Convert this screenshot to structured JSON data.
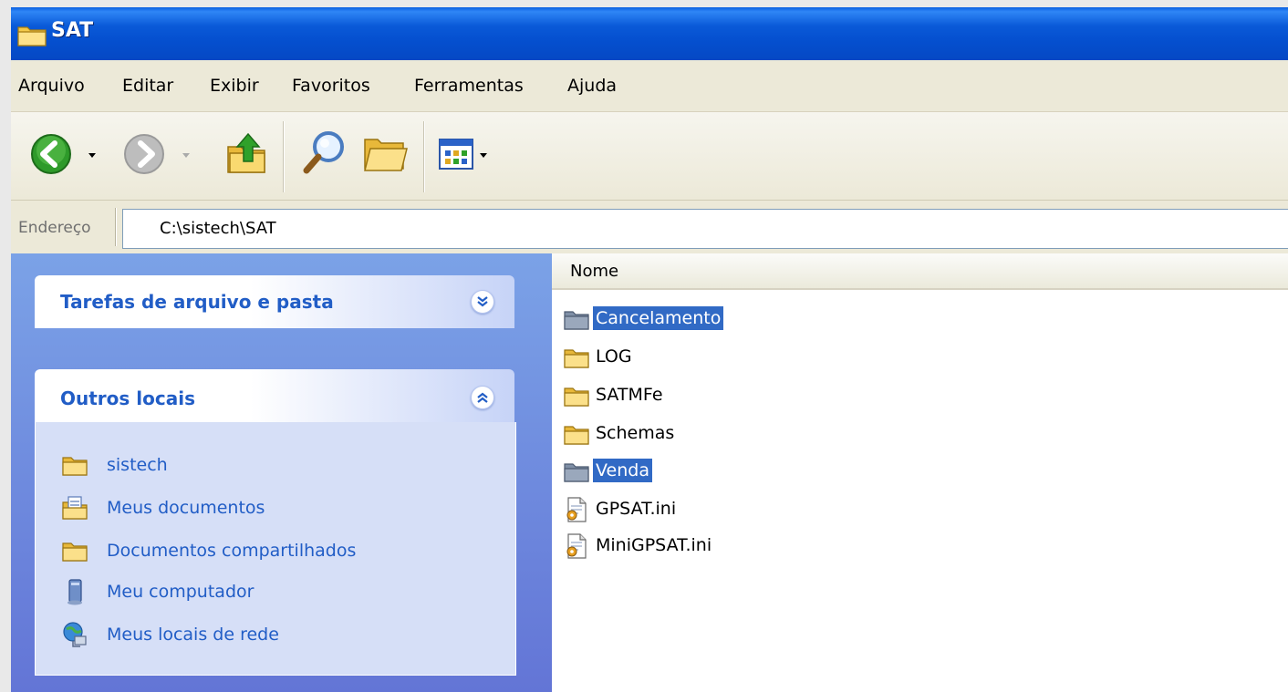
{
  "window": {
    "title": "SAT"
  },
  "menu": [
    "Arquivo",
    "Editar",
    "Exibir",
    "Favoritos",
    "Ferramentas",
    "Ajuda"
  ],
  "toolbar": {
    "buttons": [
      "back-icon",
      "forward-icon",
      "up-folder-icon",
      "search-icon",
      "folders-icon",
      "views-icon"
    ]
  },
  "address": {
    "label": "Endereço",
    "value": "C:\\sistech\\SAT"
  },
  "taskpane": {
    "file_tasks": {
      "title": "Tarefas de arquivo e pasta",
      "state": "collapsed"
    },
    "other_places": {
      "title": "Outros locais",
      "state": "expanded",
      "items": [
        {
          "label": "sistech",
          "icon": "folder-icon"
        },
        {
          "label": "Meus documentos",
          "icon": "my-documents-icon"
        },
        {
          "label": "Documentos compartilhados",
          "icon": "folder-icon"
        },
        {
          "label": "Meu computador",
          "icon": "computer-icon"
        },
        {
          "label": "Meus locais de rede",
          "icon": "network-icon"
        }
      ]
    }
  },
  "filelist": {
    "column": "Nome",
    "items": [
      {
        "name": "Cancelamento",
        "type": "folder",
        "selected": true
      },
      {
        "name": "LOG",
        "type": "folder",
        "selected": false
      },
      {
        "name": "SATMFe",
        "type": "folder",
        "selected": false
      },
      {
        "name": "Schemas",
        "type": "folder",
        "selected": false
      },
      {
        "name": "Venda",
        "type": "folder",
        "selected": true
      },
      {
        "name": "GPSAT.ini",
        "type": "ini-file",
        "selected": false
      },
      {
        "name": "MiniGPSAT.ini",
        "type": "ini-file",
        "selected": false
      }
    ]
  },
  "colors": {
    "title_bar": "#0550d0",
    "selection": "#316ac5",
    "link": "#215dc6",
    "task_pane": "#7ba2e7"
  }
}
